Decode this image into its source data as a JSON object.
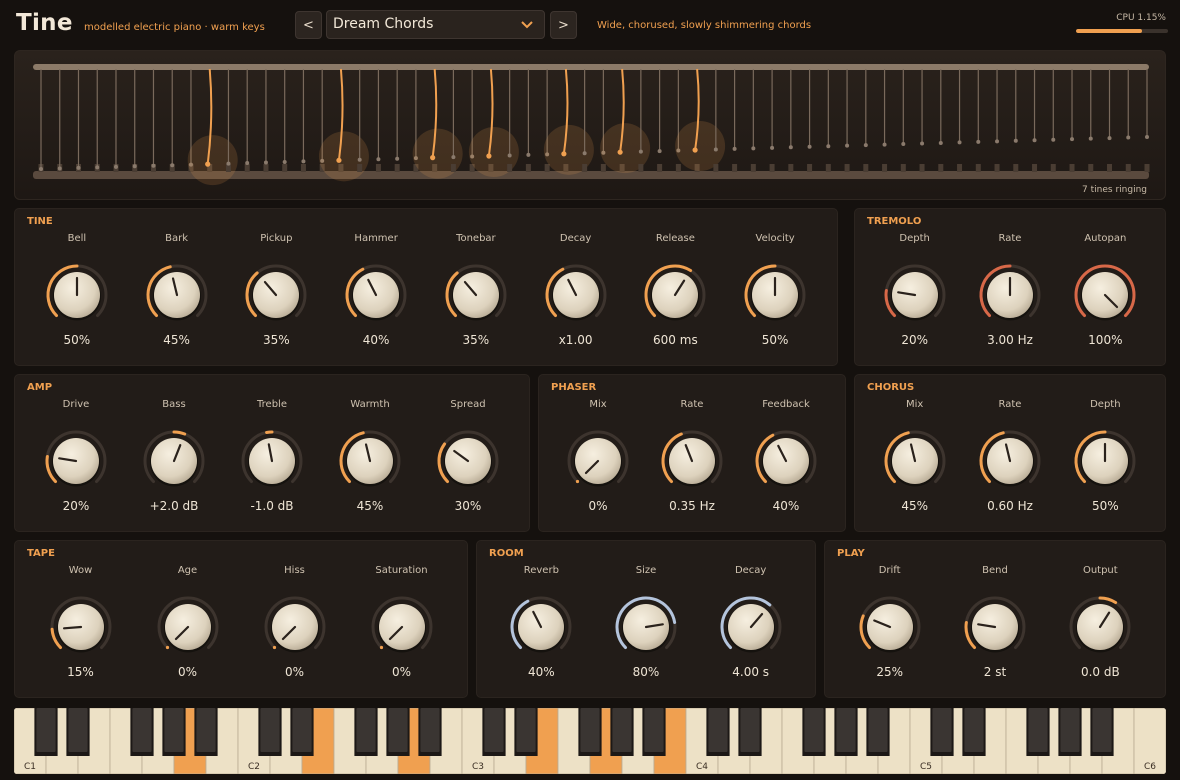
{
  "header": {
    "brand": "Tine",
    "tagline": "modelled electric piano · warm keys",
    "prev_label": "<",
    "next_label": ">",
    "preset_name": "Dream Chords",
    "preset_chevron": "chevron-down-icon",
    "preset_description": "Wide, chorused, slowly shimmering chords",
    "cpu_label": "CPU 1.15%",
    "cpu_level": 0.72
  },
  "display": {
    "status": "7 tines ringing",
    "tine_count": 60,
    "ringing_tines": [
      9,
      16,
      21,
      24,
      28,
      31,
      35
    ]
  },
  "colors": {
    "accent": "#f0a050",
    "tremolo": "#d86848",
    "room": "#b4c4dc",
    "panel": "#221c18",
    "background": "#15110e",
    "key_white": "#ede1c6",
    "key_black": "#3a3532"
  },
  "panels": {
    "tine": {
      "title": "TINE",
      "knobs": [
        {
          "label": "Bell",
          "value": "50%",
          "level": 0.5
        },
        {
          "label": "Bark",
          "value": "45%",
          "level": 0.45
        },
        {
          "label": "Pickup",
          "value": "35%",
          "level": 0.35
        },
        {
          "label": "Hammer",
          "value": "40%",
          "level": 0.4
        },
        {
          "label": "Tonebar",
          "value": "35%",
          "level": 0.35
        },
        {
          "label": "Decay",
          "value": "x1.00",
          "level": 0.4
        },
        {
          "label": "Release",
          "value": "600 ms",
          "level": 0.62
        },
        {
          "label": "Velocity",
          "value": "50%",
          "level": 0.5
        }
      ]
    },
    "tremolo": {
      "title": "TREMOLO",
      "knobs": [
        {
          "label": "Depth",
          "value": "20%",
          "level": 0.2
        },
        {
          "label": "Rate",
          "value": "3.00 Hz",
          "level": 0.5
        },
        {
          "label": "Autopan",
          "value": "100%",
          "level": 1.0
        }
      ]
    },
    "amp": {
      "title": "AMP",
      "knobs": [
        {
          "label": "Drive",
          "value": "20%",
          "level": 0.2
        },
        {
          "label": "Bass",
          "value": "+2.0 dB",
          "level": 0.58,
          "bipolar": true
        },
        {
          "label": "Treble",
          "value": "-1.0 dB",
          "level": 0.46,
          "bipolar": true
        },
        {
          "label": "Warmth",
          "value": "45%",
          "level": 0.45
        },
        {
          "label": "Spread",
          "value": "30%",
          "level": 0.3
        }
      ]
    },
    "phaser": {
      "title": "PHASER",
      "knobs": [
        {
          "label": "Mix",
          "value": "0%",
          "level": 0.0
        },
        {
          "label": "Rate",
          "value": "0.35 Hz",
          "level": 0.42
        },
        {
          "label": "Feedback",
          "value": "40%",
          "level": 0.4
        }
      ]
    },
    "chorus": {
      "title": "CHORUS",
      "knobs": [
        {
          "label": "Mix",
          "value": "45%",
          "level": 0.45
        },
        {
          "label": "Rate",
          "value": "0.60 Hz",
          "level": 0.45
        },
        {
          "label": "Depth",
          "value": "50%",
          "level": 0.5
        }
      ]
    },
    "tape": {
      "title": "TAPE",
      "knobs": [
        {
          "label": "Wow",
          "value": "15%",
          "level": 0.15
        },
        {
          "label": "Age",
          "value": "0%",
          "level": 0.0
        },
        {
          "label": "Hiss",
          "value": "0%",
          "level": 0.0
        },
        {
          "label": "Saturation",
          "value": "0%",
          "level": 0.0
        }
      ]
    },
    "room": {
      "title": "ROOM",
      "knobs": [
        {
          "label": "Reverb",
          "value": "40%",
          "level": 0.4
        },
        {
          "label": "Size",
          "value": "80%",
          "level": 0.8
        },
        {
          "label": "Decay",
          "value": "4.00 s",
          "level": 0.65
        }
      ]
    },
    "play": {
      "title": "PLAY",
      "knobs": [
        {
          "label": "Drift",
          "value": "25%",
          "level": 0.25
        },
        {
          "label": "Bend",
          "value": "2 st",
          "level": 0.2
        },
        {
          "label": "Output",
          "value": "0.0 dB",
          "level": 0.62,
          "bipolar": true
        }
      ]
    }
  },
  "keyboard": {
    "octave_labels": [
      "C1",
      "C2",
      "C3",
      "C4",
      "C5",
      "C6"
    ],
    "white_key_count": 36,
    "active_white_keys": [
      5,
      9,
      12,
      16,
      18,
      20
    ]
  }
}
